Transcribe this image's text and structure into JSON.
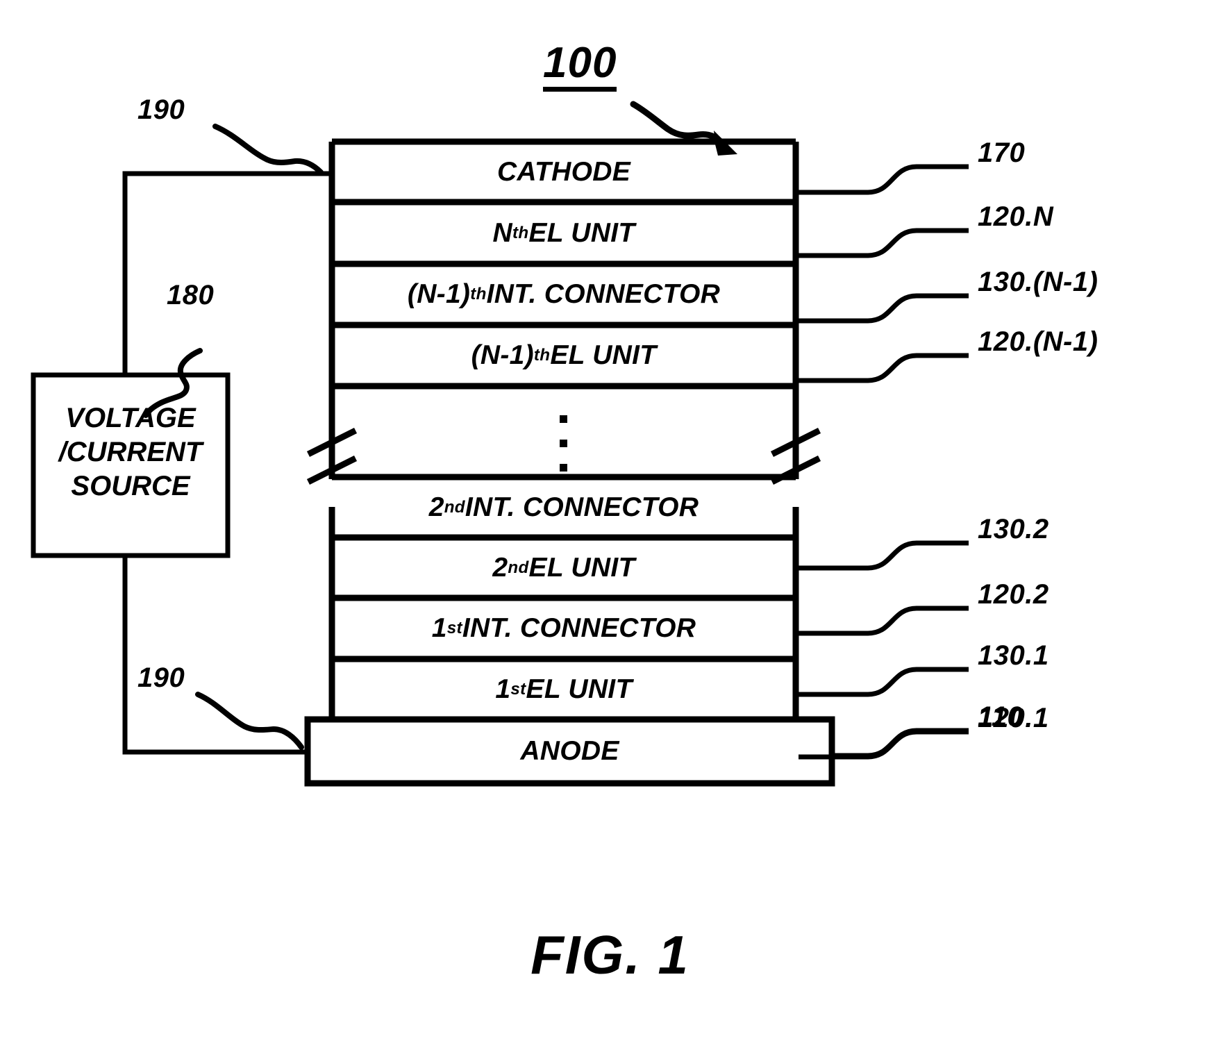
{
  "figure": {
    "caption": "FIG. 1",
    "device_number": "100"
  },
  "source_box": {
    "line1": "VOLTAGE",
    "line2": "/CURRENT",
    "line3": "SOURCE",
    "ref": "180"
  },
  "wires": {
    "top_ref": "190",
    "bottom_ref": "190"
  },
  "stack": {
    "layers": [
      {
        "name": "cathode",
        "label_main": "CATHODE",
        "prefix": "",
        "sup": "",
        "ref": "170"
      },
      {
        "name": "nth-el-unit",
        "label_main": " EL UNIT",
        "prefix": "N",
        "sup": "th",
        "ref": "120.N"
      },
      {
        "name": "n-1-int-connector",
        "label_main": " INT. CONNECTOR",
        "prefix": "(N-1)",
        "sup": "th",
        "ref": "130.(N-1)"
      },
      {
        "name": "n-1-el-unit",
        "label_main": " EL UNIT",
        "prefix": "(N-1)",
        "sup": "th",
        "ref": "120.(N-1)"
      },
      {
        "name": "second-int-connector",
        "label_main": " INT. CONNECTOR",
        "prefix": "2",
        "sup": "nd",
        "ref": "130.2"
      },
      {
        "name": "second-el-unit",
        "label_main": " EL UNIT",
        "prefix": "2",
        "sup": "nd",
        "ref": "120.2"
      },
      {
        "name": "first-int-connector",
        "label_main": " INT. CONNECTOR",
        "prefix": "1",
        "sup": "st",
        "ref": "130.1"
      },
      {
        "name": "first-el-unit",
        "label_main": " EL UNIT",
        "prefix": "1",
        "sup": "st",
        "ref": "120.1"
      },
      {
        "name": "anode",
        "label_main": "ANODE",
        "prefix": "",
        "sup": "",
        "ref": "110"
      }
    ],
    "ellipsis_marker": "vertical-ellipsis",
    "break_marker": "double-slash-break"
  },
  "colors": {
    "ink": "#000000",
    "paper": "#ffffff"
  }
}
